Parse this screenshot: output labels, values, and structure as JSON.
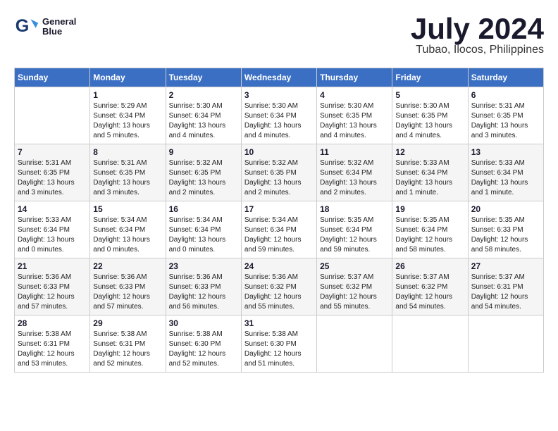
{
  "header": {
    "logo_line1": "General",
    "logo_line2": "Blue",
    "title": "July 2024",
    "subtitle": "Tubao, Ilocos, Philippines"
  },
  "columns": [
    "Sunday",
    "Monday",
    "Tuesday",
    "Wednesday",
    "Thursday",
    "Friday",
    "Saturday"
  ],
  "weeks": [
    {
      "days": [
        {
          "num": "",
          "info": ""
        },
        {
          "num": "1",
          "info": "Sunrise: 5:29 AM\nSunset: 6:34 PM\nDaylight: 13 hours\nand 5 minutes."
        },
        {
          "num": "2",
          "info": "Sunrise: 5:30 AM\nSunset: 6:34 PM\nDaylight: 13 hours\nand 4 minutes."
        },
        {
          "num": "3",
          "info": "Sunrise: 5:30 AM\nSunset: 6:34 PM\nDaylight: 13 hours\nand 4 minutes."
        },
        {
          "num": "4",
          "info": "Sunrise: 5:30 AM\nSunset: 6:35 PM\nDaylight: 13 hours\nand 4 minutes."
        },
        {
          "num": "5",
          "info": "Sunrise: 5:30 AM\nSunset: 6:35 PM\nDaylight: 13 hours\nand 4 minutes."
        },
        {
          "num": "6",
          "info": "Sunrise: 5:31 AM\nSunset: 6:35 PM\nDaylight: 13 hours\nand 3 minutes."
        }
      ]
    },
    {
      "days": [
        {
          "num": "7",
          "info": "Sunrise: 5:31 AM\nSunset: 6:35 PM\nDaylight: 13 hours\nand 3 minutes."
        },
        {
          "num": "8",
          "info": "Sunrise: 5:31 AM\nSunset: 6:35 PM\nDaylight: 13 hours\nand 3 minutes."
        },
        {
          "num": "9",
          "info": "Sunrise: 5:32 AM\nSunset: 6:35 PM\nDaylight: 13 hours\nand 2 minutes."
        },
        {
          "num": "10",
          "info": "Sunrise: 5:32 AM\nSunset: 6:35 PM\nDaylight: 13 hours\nand 2 minutes."
        },
        {
          "num": "11",
          "info": "Sunrise: 5:32 AM\nSunset: 6:34 PM\nDaylight: 13 hours\nand 2 minutes."
        },
        {
          "num": "12",
          "info": "Sunrise: 5:33 AM\nSunset: 6:34 PM\nDaylight: 13 hours\nand 1 minute."
        },
        {
          "num": "13",
          "info": "Sunrise: 5:33 AM\nSunset: 6:34 PM\nDaylight: 13 hours\nand 1 minute."
        }
      ]
    },
    {
      "days": [
        {
          "num": "14",
          "info": "Sunrise: 5:33 AM\nSunset: 6:34 PM\nDaylight: 13 hours\nand 0 minutes."
        },
        {
          "num": "15",
          "info": "Sunrise: 5:34 AM\nSunset: 6:34 PM\nDaylight: 13 hours\nand 0 minutes."
        },
        {
          "num": "16",
          "info": "Sunrise: 5:34 AM\nSunset: 6:34 PM\nDaylight: 13 hours\nand 0 minutes."
        },
        {
          "num": "17",
          "info": "Sunrise: 5:34 AM\nSunset: 6:34 PM\nDaylight: 12 hours\nand 59 minutes."
        },
        {
          "num": "18",
          "info": "Sunrise: 5:35 AM\nSunset: 6:34 PM\nDaylight: 12 hours\nand 59 minutes."
        },
        {
          "num": "19",
          "info": "Sunrise: 5:35 AM\nSunset: 6:34 PM\nDaylight: 12 hours\nand 58 minutes."
        },
        {
          "num": "20",
          "info": "Sunrise: 5:35 AM\nSunset: 6:33 PM\nDaylight: 12 hours\nand 58 minutes."
        }
      ]
    },
    {
      "days": [
        {
          "num": "21",
          "info": "Sunrise: 5:36 AM\nSunset: 6:33 PM\nDaylight: 12 hours\nand 57 minutes."
        },
        {
          "num": "22",
          "info": "Sunrise: 5:36 AM\nSunset: 6:33 PM\nDaylight: 12 hours\nand 57 minutes."
        },
        {
          "num": "23",
          "info": "Sunrise: 5:36 AM\nSunset: 6:33 PM\nDaylight: 12 hours\nand 56 minutes."
        },
        {
          "num": "24",
          "info": "Sunrise: 5:36 AM\nSunset: 6:32 PM\nDaylight: 12 hours\nand 55 minutes."
        },
        {
          "num": "25",
          "info": "Sunrise: 5:37 AM\nSunset: 6:32 PM\nDaylight: 12 hours\nand 55 minutes."
        },
        {
          "num": "26",
          "info": "Sunrise: 5:37 AM\nSunset: 6:32 PM\nDaylight: 12 hours\nand 54 minutes."
        },
        {
          "num": "27",
          "info": "Sunrise: 5:37 AM\nSunset: 6:31 PM\nDaylight: 12 hours\nand 54 minutes."
        }
      ]
    },
    {
      "days": [
        {
          "num": "28",
          "info": "Sunrise: 5:38 AM\nSunset: 6:31 PM\nDaylight: 12 hours\nand 53 minutes."
        },
        {
          "num": "29",
          "info": "Sunrise: 5:38 AM\nSunset: 6:31 PM\nDaylight: 12 hours\nand 52 minutes."
        },
        {
          "num": "30",
          "info": "Sunrise: 5:38 AM\nSunset: 6:30 PM\nDaylight: 12 hours\nand 52 minutes."
        },
        {
          "num": "31",
          "info": "Sunrise: 5:38 AM\nSunset: 6:30 PM\nDaylight: 12 hours\nand 51 minutes."
        },
        {
          "num": "",
          "info": ""
        },
        {
          "num": "",
          "info": ""
        },
        {
          "num": "",
          "info": ""
        }
      ]
    }
  ]
}
